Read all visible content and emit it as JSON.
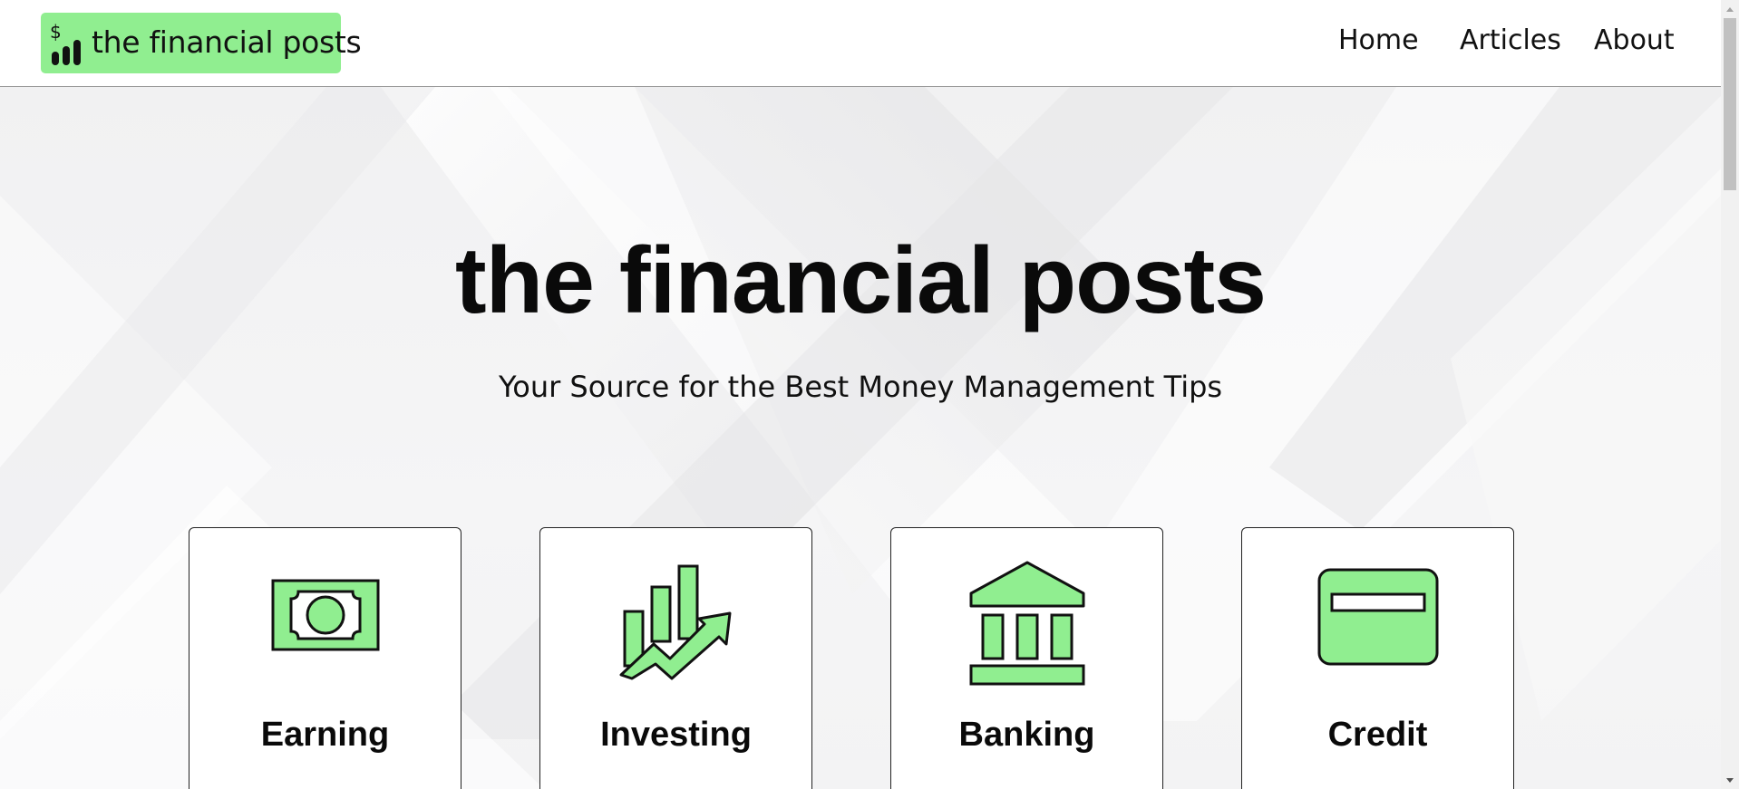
{
  "header": {
    "brand": {
      "text": "the financial posts",
      "icon": "dollar-chart-icon",
      "bg_color": "#90ee90"
    },
    "nav": [
      {
        "label": "Home"
      },
      {
        "label": "Articles"
      },
      {
        "label": "About"
      }
    ]
  },
  "hero": {
    "title": "the financial posts",
    "subtitle": "Your Source for the Best Money Management Tips"
  },
  "categories": [
    {
      "label": "Earning",
      "icon": "money-bill-icon"
    },
    {
      "label": "Investing",
      "icon": "growth-chart-icon"
    },
    {
      "label": "Banking",
      "icon": "bank-icon"
    },
    {
      "label": "Credit",
      "icon": "credit-card-icon"
    }
  ],
  "colors": {
    "accent": "#90ee90",
    "text": "#0a0a0a",
    "background": "#f3f3f4"
  }
}
